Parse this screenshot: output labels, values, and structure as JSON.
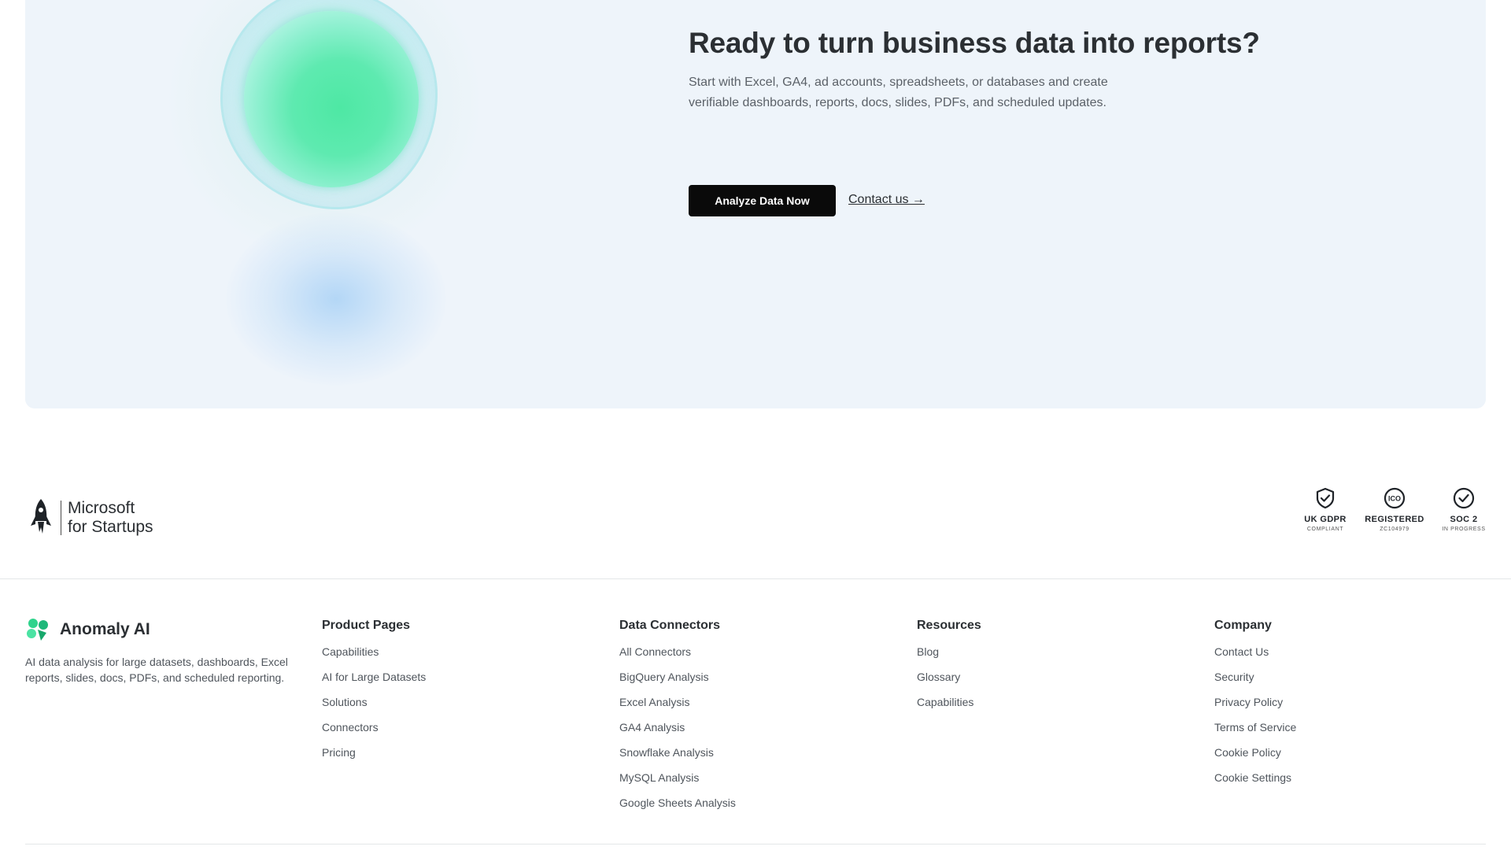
{
  "cta": {
    "heading": "Ready to turn business data into reports?",
    "description": "Start with Excel, GA4, ad accounts, spreadsheets, or databases and create verifiable dashboards, reports, docs, slides, PDFs, and scheduled updates.",
    "primary_button": "Analyze Data Now",
    "contact_link": "Contact us →"
  },
  "partner": {
    "line1": "Microsoft",
    "line2": "for Startups"
  },
  "badges": [
    {
      "title": "UK GDPR",
      "subtitle": "COMPLIANT",
      "icon": "shield-check-icon"
    },
    {
      "title": "REGISTERED",
      "subtitle": "ZC104979",
      "icon": "ico-icon"
    },
    {
      "title": "SOC 2",
      "subtitle": "IN PROGRESS",
      "icon": "check-circle-icon"
    }
  ],
  "brand": {
    "name": "Anomaly AI",
    "description": "AI data analysis for large datasets, dashboards, Excel reports, slides, docs, PDFs, and scheduled reporting."
  },
  "footer": {
    "columns": [
      {
        "heading": "Product Pages",
        "links": [
          "Capabilities",
          "AI for Large Datasets",
          "Solutions",
          "Connectors",
          "Pricing"
        ]
      },
      {
        "heading": "Data Connectors",
        "links": [
          "All Connectors",
          "BigQuery Analysis",
          "Excel Analysis",
          "GA4 Analysis",
          "Snowflake Analysis",
          "MySQL Analysis",
          "Google Sheets Analysis"
        ]
      },
      {
        "heading": "Resources",
        "links": [
          "Blog",
          "Glossary",
          "Capabilities"
        ]
      },
      {
        "heading": "Company",
        "links": [
          "Contact Us",
          "Security",
          "Privacy Policy",
          "Terms of Service",
          "Cookie Policy",
          "Cookie Settings"
        ]
      }
    ]
  },
  "colors": {
    "cta_background": "#eef4fa",
    "primary_button": "#0a0a0a",
    "brand_green": "#2fd38c"
  }
}
